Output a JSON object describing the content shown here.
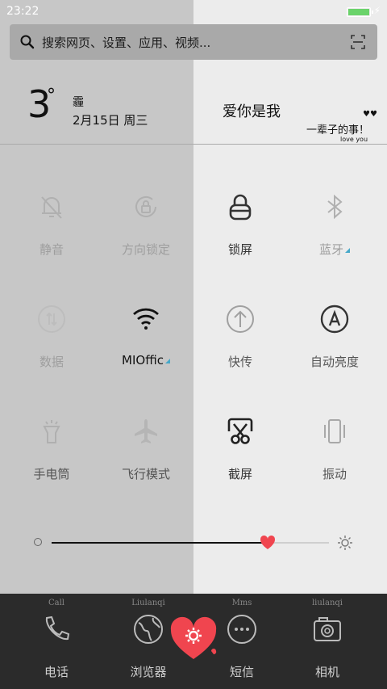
{
  "status": {
    "time": "23:22"
  },
  "search": {
    "placeholder": "搜索网页、设置、应用、视频..."
  },
  "weather": {
    "temperature": "3",
    "degree_symbol": "°",
    "condition": "霾",
    "date": "2月15日 周三",
    "quote_title": "爱你是我",
    "quote_sub": "一辈子的事！",
    "quote_small": "love you"
  },
  "toggles": [
    {
      "label": "静音",
      "icon": "mute-bell-icon",
      "state": "off"
    },
    {
      "label": "方向锁定",
      "icon": "rotation-lock-icon",
      "state": "off"
    },
    {
      "label": "锁屏",
      "icon": "lock-icon",
      "state": "on"
    },
    {
      "label": "蓝牙",
      "icon": "bluetooth-icon",
      "state": "off"
    },
    {
      "label": "数据",
      "icon": "mobile-data-icon",
      "state": "off"
    },
    {
      "label": "MIOffic",
      "icon": "wifi-icon",
      "state": "on"
    },
    {
      "label": "快传",
      "icon": "quick-transfer-icon",
      "state": "off"
    },
    {
      "label": "自动亮度",
      "icon": "auto-brightness-icon",
      "state": "on"
    },
    {
      "label": "手电筒",
      "icon": "flashlight-icon",
      "state": "off"
    },
    {
      "label": "飞行模式",
      "icon": "airplane-icon",
      "state": "off"
    },
    {
      "label": "截屏",
      "icon": "screenshot-icon",
      "state": "on"
    },
    {
      "label": "振动",
      "icon": "vibrate-icon",
      "state": "off"
    }
  ],
  "brightness": {
    "level": 0.78
  },
  "dock": [
    {
      "caption": "Call",
      "name": "电话",
      "icon": "phone-icon"
    },
    {
      "caption": "Liulanqi",
      "name": "浏览器",
      "icon": "globe-icon"
    },
    {
      "caption": "Mms",
      "name": "短信",
      "icon": "message-icon"
    },
    {
      "caption": "liulanqi",
      "name": "相机",
      "icon": "camera-icon"
    }
  ],
  "colors": {
    "accent_heart": "#f0454f",
    "selection_triangle": "#46a8c9"
  }
}
